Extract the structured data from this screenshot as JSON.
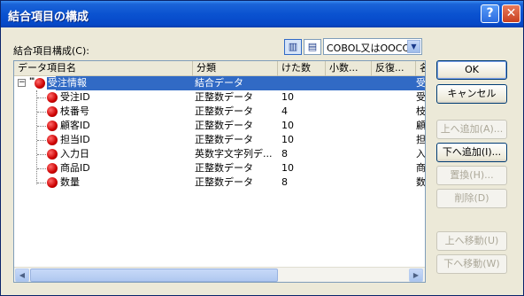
{
  "window": {
    "title": "結合項目の構成"
  },
  "titlebar": {
    "help_glyph": "?",
    "close_glyph": "✕"
  },
  "section_label": "結合項目構成(C):",
  "view_buttons": [
    {
      "icon": "column-view-icon",
      "glyph": "▥"
    },
    {
      "icon": "row-view-icon",
      "glyph": "▤"
    }
  ],
  "combo": {
    "value": "COBOL又はOOCC",
    "arrow": "▼"
  },
  "columns": [
    "データ項目名",
    "分類",
    "けた数",
    "小数...",
    "反復...",
    "名"
  ],
  "root": {
    "name": "受注情報",
    "type": "結合データ",
    "digits": "",
    "last": "受",
    "expander": "−",
    "key_label": "'''"
  },
  "rows": [
    {
      "name": "受注ID",
      "type": "正整数データ",
      "digits": "10",
      "last": "受"
    },
    {
      "name": "枝番号",
      "type": "正整数データ",
      "digits": "4",
      "last": "枝"
    },
    {
      "name": "顧客ID",
      "type": "正整数データ",
      "digits": "10",
      "last": "顧"
    },
    {
      "name": "担当ID",
      "type": "正整数データ",
      "digits": "10",
      "last": "担"
    },
    {
      "name": "入力日",
      "type": "英数字文字列デ...",
      "digits": "8",
      "last": "入"
    },
    {
      "name": "商品ID",
      "type": "正整数データ",
      "digits": "10",
      "last": "商"
    },
    {
      "name": "数量",
      "type": "正整数データ",
      "digits": "8",
      "last": "数"
    }
  ],
  "scrollbar": {
    "left": "◀",
    "right": "▶"
  },
  "buttons": {
    "ok": "OK",
    "cancel": "キャンセル",
    "add_above": "上へ追加(A)...",
    "add_below": "下へ追加(I)...",
    "replace": "置換(H)...",
    "delete": "削除(D)",
    "move_up": "上へ移動(U)",
    "move_down": "下へ移動(W)"
  },
  "colors": {
    "selection": "#316ac5",
    "titlebar": "#0a52d0",
    "dialog_bg": "#ece9d8"
  }
}
